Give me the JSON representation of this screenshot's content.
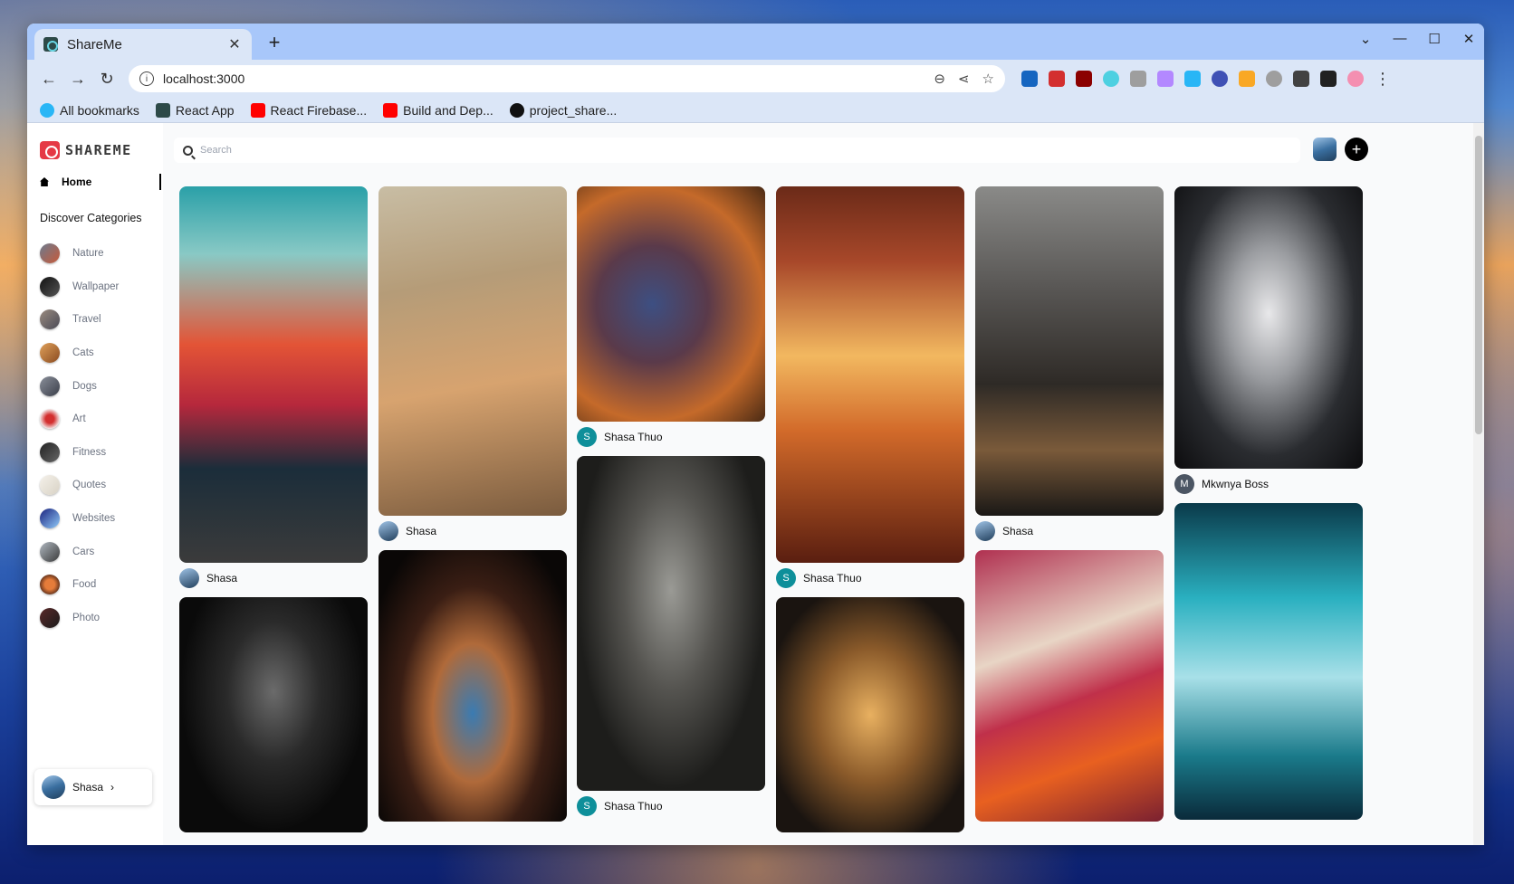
{
  "browser": {
    "tab_title": "ShareMe",
    "url": "localhost:3000",
    "bookmarks": [
      "All bookmarks",
      "React App",
      "React Firebase...",
      "Build and Dep...",
      "project_share..."
    ]
  },
  "app": {
    "brand": "SHAREME",
    "home_label": "Home",
    "discover_label": "Discover Categories",
    "categories": [
      "Nature",
      "Wallpaper",
      "Travel",
      "Cats",
      "Dogs",
      "Art",
      "Fitness",
      "Quotes",
      "Websites",
      "Cars",
      "Food",
      "Photo"
    ],
    "search_placeholder": "Search",
    "user_name": "Shasa",
    "user_chevron": "›"
  },
  "pins": {
    "col1": [
      {
        "author": "Shasa",
        "initial": ""
      },
      {
        "author": "",
        "initial": ""
      }
    ],
    "col2": [
      {
        "author": "Shasa",
        "initial": ""
      },
      {
        "author": "",
        "initial": ""
      }
    ],
    "col3": [
      {
        "author": "Shasa Thuo",
        "initial": "S"
      },
      {
        "author": "Shasa Thuo",
        "initial": "S"
      }
    ],
    "col4": [
      {
        "author": "Shasa Thuo",
        "initial": "S"
      },
      {
        "author": "",
        "initial": ""
      }
    ],
    "col5": [
      {
        "author": "Shasa",
        "initial": ""
      },
      {
        "author": "",
        "initial": ""
      }
    ],
    "col6": [
      {
        "author": "Mkwnya Boss",
        "initial": "M"
      },
      {
        "author": "",
        "initial": ""
      }
    ]
  },
  "colors": {
    "brand_red": "#e53945",
    "teal_avatar": "#0e8f9a",
    "gray_avatar": "#4b5563",
    "chrome_tab_bg": "#a8c7fa",
    "chrome_toolbar_bg": "#dbe6f7"
  }
}
